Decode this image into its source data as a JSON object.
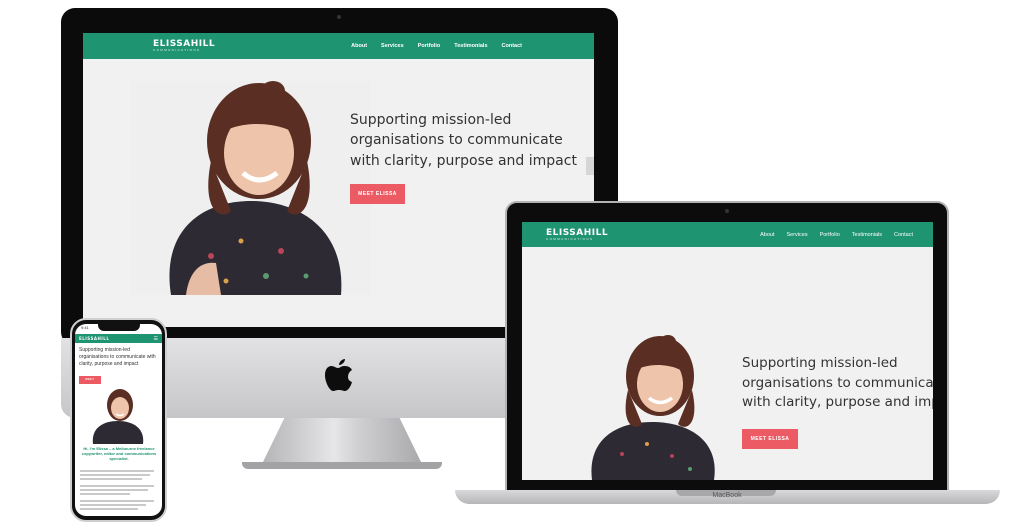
{
  "site": {
    "logo_main": "ELISSAHILL",
    "logo_sub": "COMMUNICATIONS",
    "nav": [
      "About",
      "Services",
      "Portfolio",
      "Testimonials",
      "Contact"
    ],
    "hero_line1": "Supporting mission-led",
    "hero_line2": "organisations to communicate",
    "hero_line3": "with clarity, purpose and impact",
    "cta": "MEET ELISSA",
    "brand_green": "#1f9471",
    "cta_color": "#ec5b63"
  },
  "phone": {
    "time": "9:41",
    "hero": "Supporting mission-led organisations to communicate with clarity, purpose and impact",
    "intro_heading": "Hi, I'm Elissa – a Melbourne freelance copywriter, editor and communications specialist."
  },
  "laptop_brand": "MacBook"
}
